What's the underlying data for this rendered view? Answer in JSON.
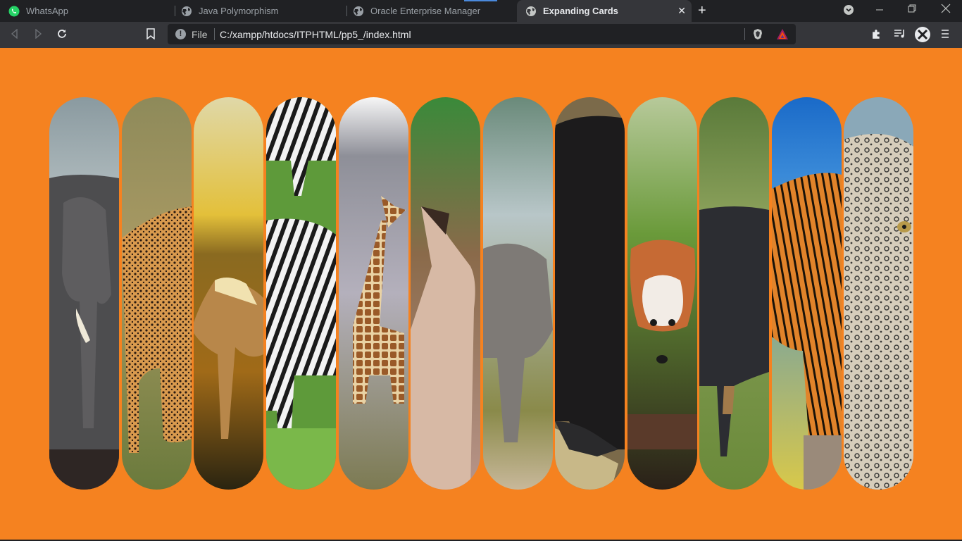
{
  "browser": {
    "tabs": [
      {
        "label": "WhatsApp",
        "icon": "whatsapp-icon",
        "active": false
      },
      {
        "label": "Java Polymorphism",
        "icon": "globe-icon",
        "active": false
      },
      {
        "label": "Oracle Enterprise Manager",
        "icon": "globe-icon",
        "active": false
      },
      {
        "label": "Expanding Cards",
        "icon": "globe-icon",
        "active": true
      }
    ],
    "close_tab": "✕",
    "new_tab": "+",
    "address": {
      "scheme_label": "File",
      "url": "C:/xampp/htdocs/ITPHTML/pp5_/index.html"
    }
  },
  "colors": {
    "page_background": "#f58220",
    "chrome_dark": "#202124",
    "chrome_toolbar": "#35363a"
  },
  "cards": [
    {
      "subject": "elephant"
    },
    {
      "subject": "cheetah"
    },
    {
      "subject": "horse"
    },
    {
      "subject": "zebra"
    },
    {
      "subject": "giraffe"
    },
    {
      "subject": "antelope"
    },
    {
      "subject": "rhinoceros"
    },
    {
      "subject": "gorilla"
    },
    {
      "subject": "red-panda"
    },
    {
      "subject": "wild-boar"
    },
    {
      "subject": "tiger"
    },
    {
      "subject": "snow-leopard"
    }
  ]
}
